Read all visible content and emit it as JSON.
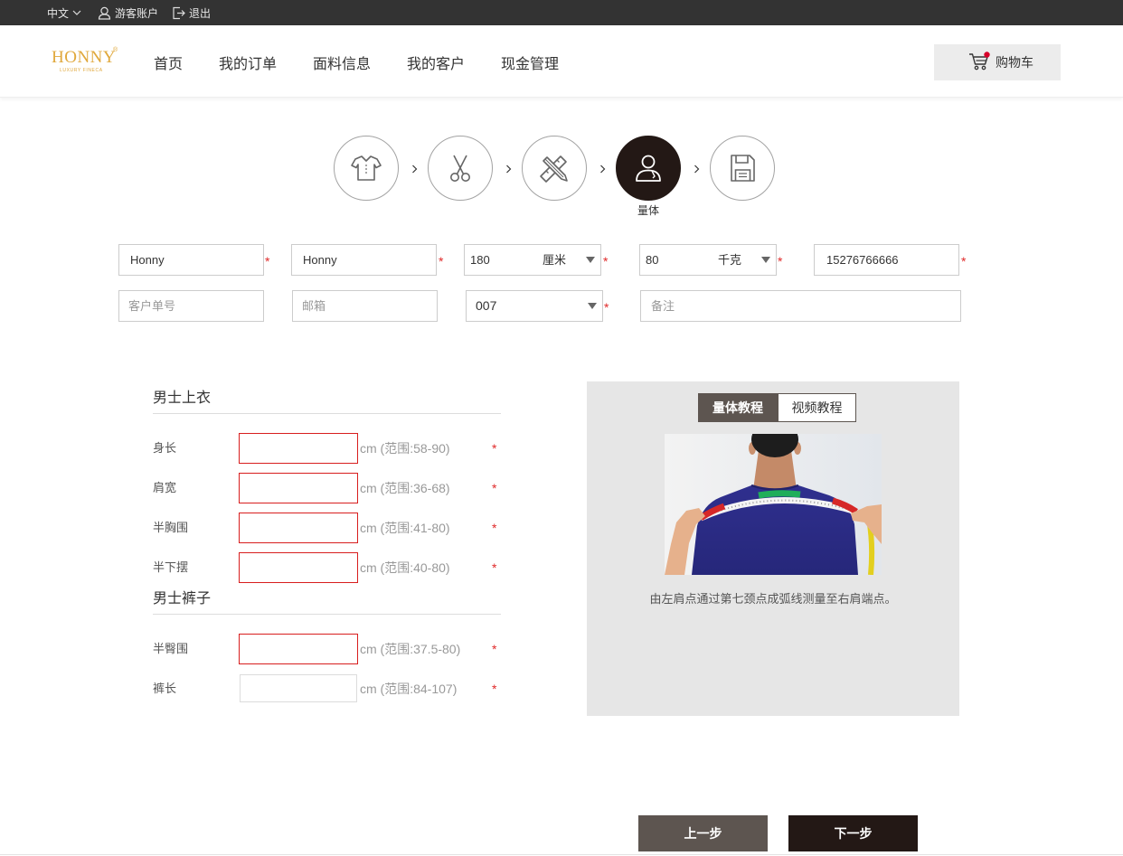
{
  "topbar": {
    "language": "中文",
    "account": "游客账户",
    "logout": "退出"
  },
  "logo": {
    "name": "HONNY",
    "mark": "®",
    "tagline": "LUXURY FINECA"
  },
  "nav": [
    "首页",
    "我的订单",
    "面料信息",
    "我的客户",
    "现金管理"
  ],
  "cart": {
    "label": "购物车",
    "has_items": true
  },
  "steps": [
    {
      "icon": "shirt-icon",
      "active": false
    },
    {
      "icon": "scissors-icon",
      "active": false
    },
    {
      "icon": "ruler-pencil-icon",
      "active": false
    },
    {
      "icon": "person-measure-icon",
      "active": true,
      "label": "量体"
    },
    {
      "icon": "save-icon",
      "active": false
    }
  ],
  "required_mark": "*",
  "customer_form": {
    "customer_name": {
      "value": "Honny",
      "required": true
    },
    "contact_name": {
      "value": "Honny",
      "required": true
    },
    "height": {
      "value": "180",
      "unit": "厘米",
      "required": true
    },
    "weight": {
      "value": "80",
      "unit": "千克",
      "required": true
    },
    "phone": {
      "value": "15276766666",
      "required": true
    },
    "order_no": {
      "value": "",
      "placeholder": "客户单号"
    },
    "email": {
      "value": "",
      "placeholder": "邮箱"
    },
    "size_code": {
      "value": "007",
      "required": true
    },
    "remark": {
      "value": "",
      "placeholder": "备注"
    }
  },
  "measurements": {
    "sections": [
      {
        "title": "男士上衣",
        "rows": [
          {
            "label": "身长",
            "value": "",
            "hint": "cm (范围:58-90)",
            "invalid": true,
            "required": true
          },
          {
            "label": "肩宽",
            "value": "",
            "hint": "cm (范围:36-68)",
            "invalid": true,
            "required": true
          },
          {
            "label": "半胸围",
            "value": "",
            "hint": "cm (范围:41-80)",
            "invalid": true,
            "required": true
          },
          {
            "label": "半下摆",
            "value": "",
            "hint": "cm (范围:40-80)",
            "invalid": true,
            "required": true
          }
        ]
      },
      {
        "title": "男士裤子",
        "rows": [
          {
            "label": "半臀围",
            "value": "",
            "hint": "cm (范围:37.5-80)",
            "invalid": true,
            "required": true
          },
          {
            "label": "裤长",
            "value": "",
            "hint": "cm (范围:84-107)",
            "invalid": false,
            "required": true
          }
        ]
      }
    ]
  },
  "tutorial": {
    "tabs": [
      {
        "label": "量体教程",
        "active": true
      },
      {
        "label": "视频教程",
        "active": false
      }
    ],
    "caption": "由左肩点通过第七颈点成弧线测量至右肩端点。"
  },
  "actions": {
    "prev": "上一步",
    "next": "下一步"
  },
  "colors": {
    "topbar": "#333333",
    "brand_gold": "#e0a83c",
    "active_dark": "#231815",
    "secondary": "#5d5550",
    "error_border": "#d81e1e",
    "required": "#e02a2a",
    "panel": "#e6e6e6"
  }
}
